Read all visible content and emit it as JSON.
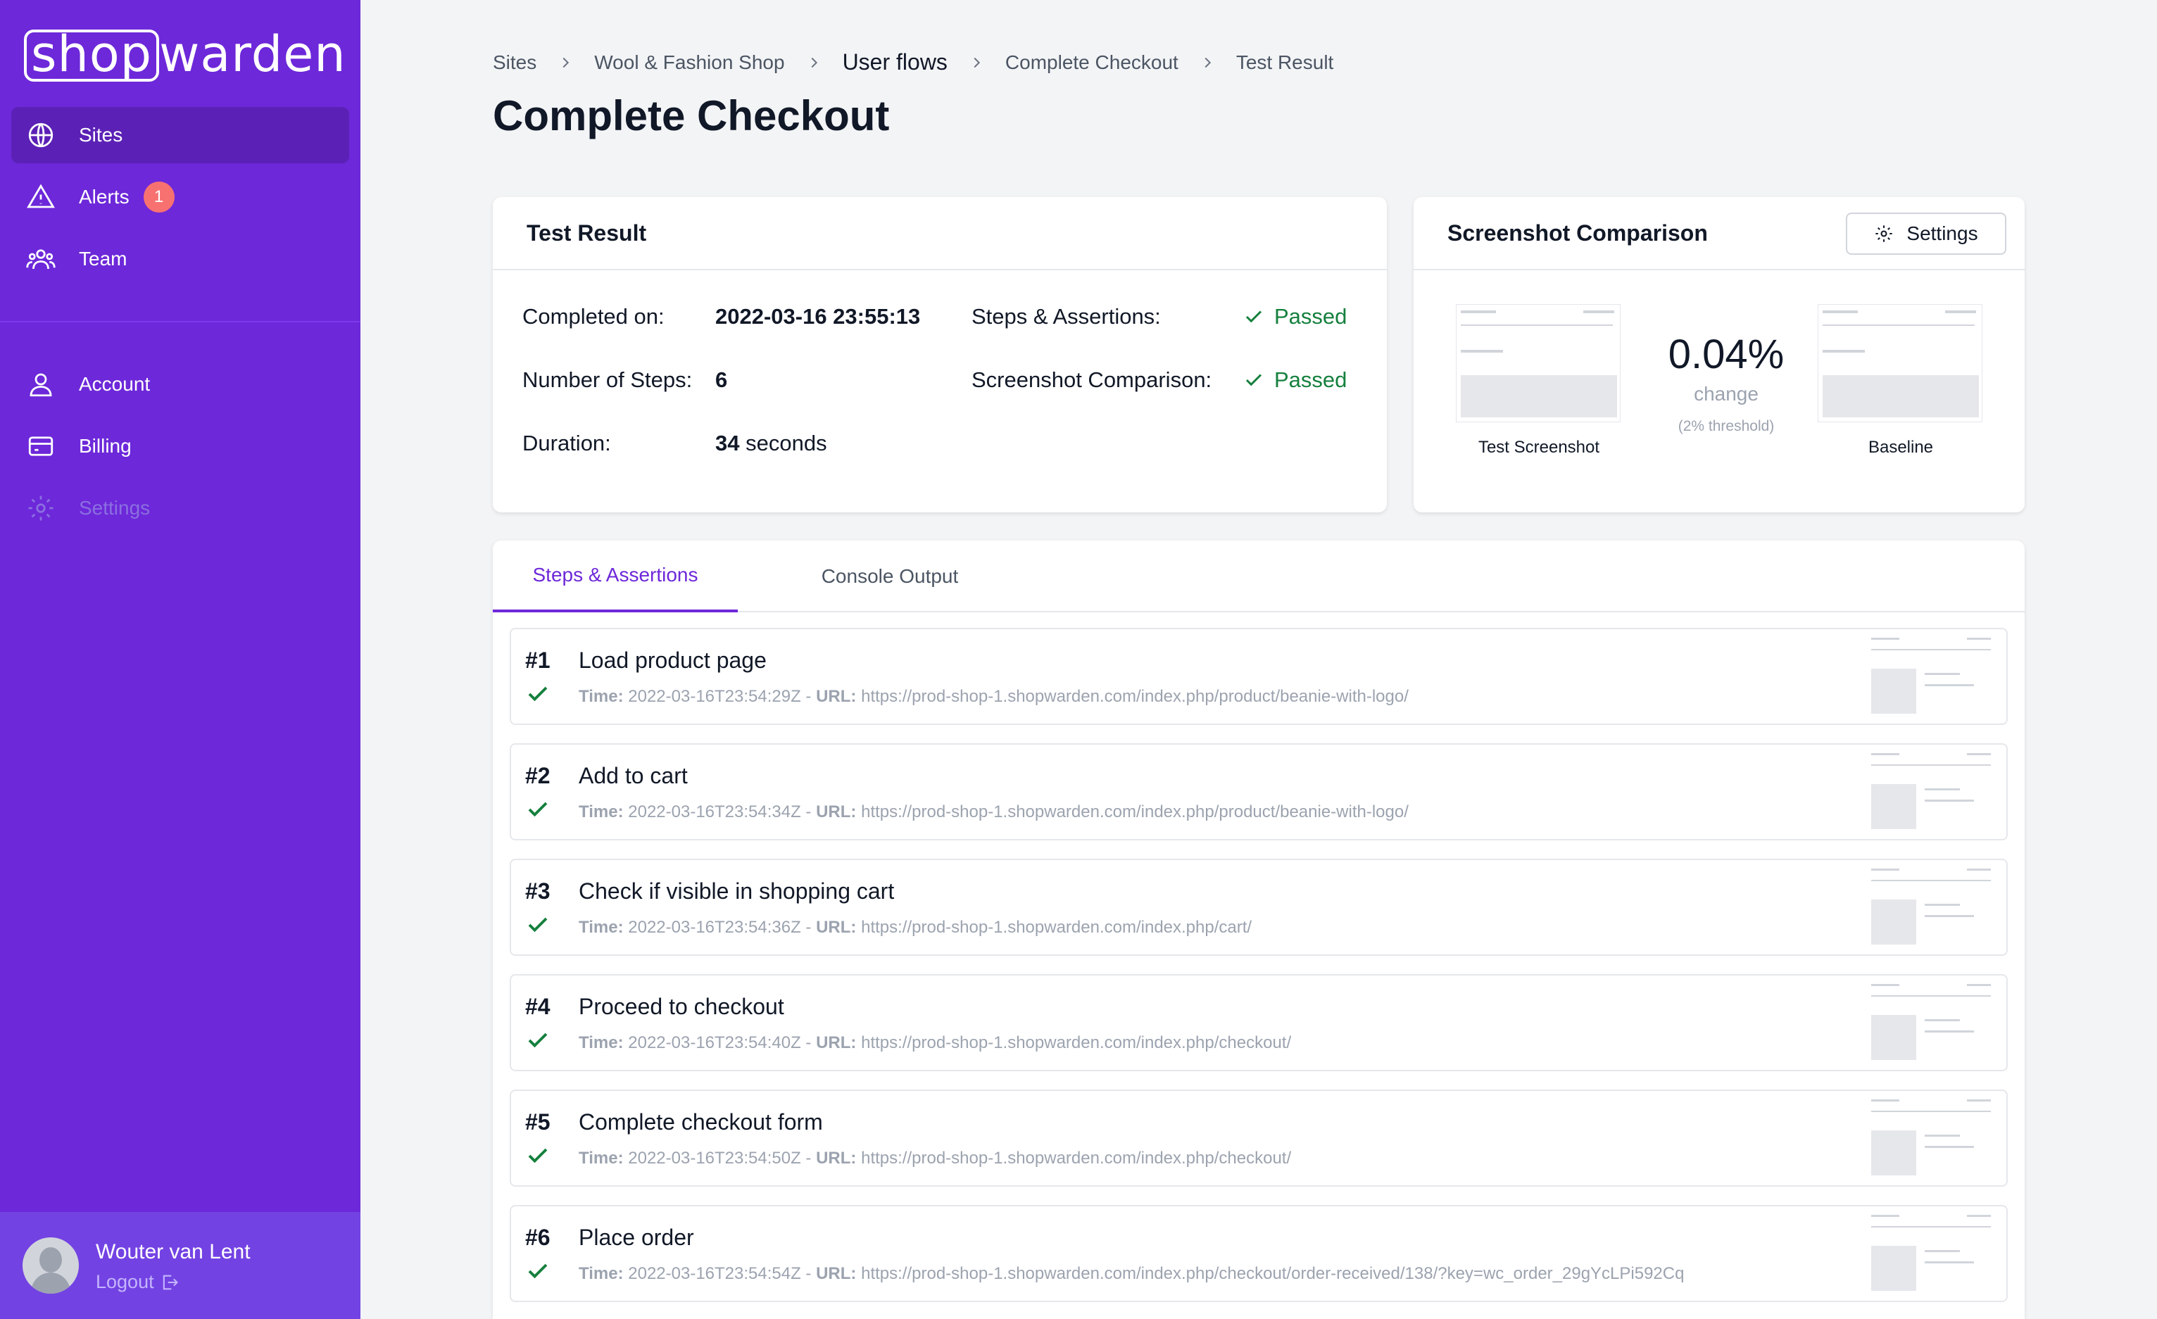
{
  "sidebar": {
    "logo": "shopwarden",
    "logo_boxed": "shop",
    "logo_rest": "warden",
    "nav": [
      {
        "label": "Sites",
        "icon": "globe-icon",
        "active": true
      },
      {
        "label": "Alerts",
        "icon": "warning-triangle-icon",
        "badge": "1"
      },
      {
        "label": "Team",
        "icon": "users-icon"
      }
    ],
    "nav2": [
      {
        "label": "Account",
        "icon": "user-icon"
      },
      {
        "label": "Billing",
        "icon": "credit-card-icon"
      },
      {
        "label": "Settings",
        "icon": "gear-icon",
        "disabled": true
      }
    ],
    "user": {
      "name": "Wouter van Lent",
      "logout": "Logout"
    }
  },
  "breadcrumb": [
    "Sites",
    "Wool & Fashion Shop",
    "User flows",
    "Complete Checkout",
    "Test Result"
  ],
  "page_title": "Complete Checkout",
  "test_result": {
    "header": "Test Result",
    "completed_label": "Completed on:",
    "completed_value": "2022-03-16 23:55:13",
    "steps_label": "Number of Steps:",
    "steps_value": "6",
    "duration_label": "Duration:",
    "duration_number": "34",
    "duration_unit": "seconds",
    "assertions_label": "Steps & Assertions:",
    "assertions_status": "Passed",
    "comparison_label": "Screenshot Comparison:",
    "comparison_status": "Passed"
  },
  "screenshot_comparison": {
    "header": "Screenshot Comparison",
    "settings_button": "Settings",
    "change_value": "0.04%",
    "change_word": "change",
    "threshold": "(2% threshold)",
    "test_label": "Test Screenshot",
    "baseline_label": "Baseline"
  },
  "tabs": [
    "Steps & Assertions",
    "Console Output"
  ],
  "meta_labels": {
    "time": "Time:",
    "url": "URL:"
  },
  "steps": [
    {
      "num": "#1",
      "title": "Load product page",
      "time": "2022-03-16T23:54:29Z",
      "url": "https://prod-shop-1.shopwarden.com/index.php/product/beanie-with-logo/"
    },
    {
      "num": "#2",
      "title": "Add to cart",
      "time": "2022-03-16T23:54:34Z",
      "url": "https://prod-shop-1.shopwarden.com/index.php/product/beanie-with-logo/"
    },
    {
      "num": "#3",
      "title": "Check if visible in shopping cart",
      "time": "2022-03-16T23:54:36Z",
      "url": "https://prod-shop-1.shopwarden.com/index.php/cart/"
    },
    {
      "num": "#4",
      "title": "Proceed to checkout",
      "time": "2022-03-16T23:54:40Z",
      "url": "https://prod-shop-1.shopwarden.com/index.php/checkout/"
    },
    {
      "num": "#5",
      "title": "Complete checkout form",
      "time": "2022-03-16T23:54:50Z",
      "url": "https://prod-shop-1.shopwarden.com/index.php/checkout/"
    },
    {
      "num": "#6",
      "title": "Place order",
      "time": "2022-03-16T23:54:54Z",
      "url": "https://prod-shop-1.shopwarden.com/index.php/checkout/order-received/138/?key=wc_order_29gYcLPi592Cq"
    }
  ],
  "colors": {
    "sidebar": "#6d28d9",
    "accent": "#6d28d9",
    "success": "#15803d",
    "badge": "#f87171"
  }
}
